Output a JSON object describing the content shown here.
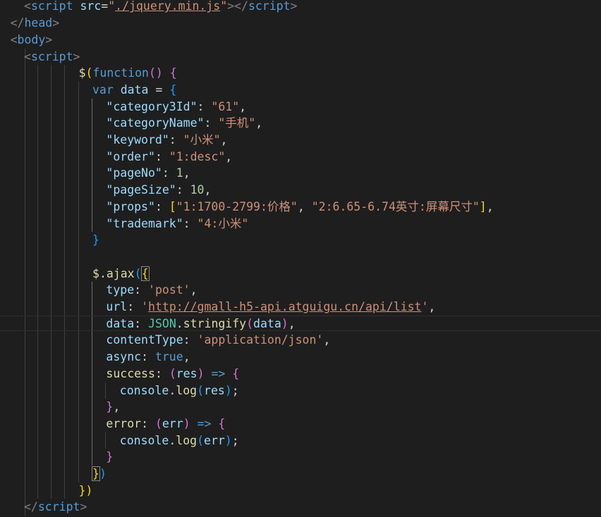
{
  "lines": [
    {
      "indent": 1,
      "tokens": [
        [
          "tk-punct",
          "<"
        ],
        [
          "tk-tag",
          "script"
        ],
        [
          "tk-plain",
          " "
        ],
        [
          "tk-attr",
          "src"
        ],
        [
          "tk-plain",
          "="
        ],
        [
          "tk-str",
          "\""
        ],
        [
          "tk-str u",
          "./jquery.min.js"
        ],
        [
          "tk-str",
          "\""
        ],
        [
          "tk-punct",
          "></"
        ],
        [
          "tk-tag",
          "script"
        ],
        [
          "tk-punct",
          ">"
        ]
      ]
    },
    {
      "indent": 0,
      "tokens": [
        [
          "tk-punct",
          "</"
        ],
        [
          "tk-tag",
          "head"
        ],
        [
          "tk-punct",
          ">"
        ]
      ]
    },
    {
      "indent": 0,
      "tokens": [
        [
          "tk-punct",
          "<"
        ],
        [
          "tk-tag",
          "body"
        ],
        [
          "tk-punct",
          ">"
        ]
      ]
    },
    {
      "indent": 1,
      "tokens": [
        [
          "tk-punct",
          "<"
        ],
        [
          "tk-tag",
          "script"
        ],
        [
          "tk-punct",
          ">"
        ]
      ]
    },
    {
      "indent": 5,
      "tokens": [
        [
          "tk-func",
          "$"
        ],
        [
          "b1",
          "("
        ],
        [
          "tk-kw",
          "function"
        ],
        [
          "b2",
          "()"
        ],
        [
          "tk-plain",
          " "
        ],
        [
          "b2",
          "{"
        ]
      ]
    },
    {
      "indent": 6,
      "tokens": [
        [
          "tk-kw",
          "var"
        ],
        [
          "tk-plain",
          " "
        ],
        [
          "tk-var",
          "data"
        ],
        [
          "tk-plain",
          " = "
        ],
        [
          "b3",
          "{"
        ]
      ]
    },
    {
      "indent": 7,
      "tokens": [
        [
          "tk-key",
          "\"category3Id\""
        ],
        [
          "tk-plain",
          ": "
        ],
        [
          "tk-str",
          "\"61\""
        ],
        [
          "tk-plain",
          ","
        ]
      ]
    },
    {
      "indent": 7,
      "tokens": [
        [
          "tk-key",
          "\"categoryName\""
        ],
        [
          "tk-plain",
          ": "
        ],
        [
          "tk-str",
          "\"手机\""
        ],
        [
          "tk-plain",
          ","
        ]
      ]
    },
    {
      "indent": 7,
      "tokens": [
        [
          "tk-key",
          "\"keyword\""
        ],
        [
          "tk-plain",
          ": "
        ],
        [
          "tk-str",
          "\"小米\""
        ],
        [
          "tk-plain",
          ","
        ]
      ]
    },
    {
      "indent": 7,
      "tokens": [
        [
          "tk-key",
          "\"order\""
        ],
        [
          "tk-plain",
          ": "
        ],
        [
          "tk-str",
          "\"1:desc\""
        ],
        [
          "tk-plain",
          ","
        ]
      ]
    },
    {
      "indent": 7,
      "tokens": [
        [
          "tk-key",
          "\"pageNo\""
        ],
        [
          "tk-plain",
          ": "
        ],
        [
          "tk-num",
          "1"
        ],
        [
          "tk-plain",
          ","
        ]
      ]
    },
    {
      "indent": 7,
      "tokens": [
        [
          "tk-key",
          "\"pageSize\""
        ],
        [
          "tk-plain",
          ": "
        ],
        [
          "tk-num",
          "10"
        ],
        [
          "tk-plain",
          ","
        ]
      ]
    },
    {
      "indent": 7,
      "tokens": [
        [
          "tk-key",
          "\"props\""
        ],
        [
          "tk-plain",
          ": "
        ],
        [
          "b1",
          "["
        ],
        [
          "tk-str",
          "\"1:1700-2799:价格\""
        ],
        [
          "tk-plain",
          ", "
        ],
        [
          "tk-str",
          "\"2:6.65-6.74英寸:屏幕尺寸\""
        ],
        [
          "b1",
          "]"
        ],
        [
          "tk-plain",
          ","
        ]
      ]
    },
    {
      "indent": 7,
      "tokens": [
        [
          "tk-key",
          "\"trademark\""
        ],
        [
          "tk-plain",
          ": "
        ],
        [
          "tk-str",
          "\"4:小米\""
        ]
      ]
    },
    {
      "indent": 6,
      "tokens": [
        [
          "b3",
          "}"
        ]
      ]
    },
    {
      "indent": 0,
      "tokens": []
    },
    {
      "indent": 6,
      "tokens": [
        [
          "tk-func",
          "$"
        ],
        [
          "tk-plain",
          "."
        ],
        [
          "tk-func",
          "ajax"
        ],
        [
          "b3",
          "("
        ],
        [
          "b1 box",
          "{"
        ]
      ]
    },
    {
      "indent": 7,
      "tokens": [
        [
          "tk-key",
          "type"
        ],
        [
          "tk-plain",
          ": "
        ],
        [
          "tk-str",
          "'post'"
        ],
        [
          "tk-plain",
          ","
        ]
      ]
    },
    {
      "indent": 7,
      "tokens": [
        [
          "tk-key",
          "url"
        ],
        [
          "tk-plain",
          ": "
        ],
        [
          "tk-str",
          "'"
        ],
        [
          "tk-str u",
          "http://gmall-h5-api.atguigu.cn/api/list"
        ],
        [
          "tk-str",
          "'"
        ],
        [
          "tk-plain",
          ","
        ]
      ]
    },
    {
      "indent": 7,
      "tokens": [
        [
          "tk-key",
          "data"
        ],
        [
          "tk-plain",
          ": "
        ],
        [
          "tk-obj",
          "JSON"
        ],
        [
          "tk-plain",
          "."
        ],
        [
          "tk-func",
          "stringify"
        ],
        [
          "b2",
          "("
        ],
        [
          "tk-var",
          "data"
        ],
        [
          "b2",
          ")"
        ],
        [
          "tk-plain",
          ","
        ]
      ],
      "current": true
    },
    {
      "indent": 7,
      "tokens": [
        [
          "tk-key",
          "contentType"
        ],
        [
          "tk-plain",
          ": "
        ],
        [
          "tk-str",
          "'application/json'"
        ],
        [
          "tk-plain",
          ","
        ]
      ]
    },
    {
      "indent": 7,
      "tokens": [
        [
          "tk-key",
          "async"
        ],
        [
          "tk-plain",
          ": "
        ],
        [
          "tk-kw",
          "true"
        ],
        [
          "tk-plain",
          ","
        ]
      ]
    },
    {
      "indent": 7,
      "tokens": [
        [
          "tk-func",
          "success"
        ],
        [
          "tk-plain",
          ": "
        ],
        [
          "b2",
          "("
        ],
        [
          "tk-var",
          "res"
        ],
        [
          "b2",
          ")"
        ],
        [
          "tk-plain",
          " "
        ],
        [
          "tk-kw",
          "=>"
        ],
        [
          "tk-plain",
          " "
        ],
        [
          "b2",
          "{"
        ]
      ]
    },
    {
      "indent": 8,
      "tokens": [
        [
          "tk-var",
          "console"
        ],
        [
          "tk-plain",
          "."
        ],
        [
          "tk-func",
          "log"
        ],
        [
          "b3",
          "("
        ],
        [
          "tk-var",
          "res"
        ],
        [
          "b3",
          ")"
        ],
        [
          "tk-plain",
          ";"
        ]
      ]
    },
    {
      "indent": 7,
      "tokens": [
        [
          "b2",
          "}"
        ],
        [
          "tk-plain",
          ","
        ]
      ]
    },
    {
      "indent": 7,
      "tokens": [
        [
          "tk-func",
          "error"
        ],
        [
          "tk-plain",
          ": "
        ],
        [
          "b2",
          "("
        ],
        [
          "tk-var",
          "err"
        ],
        [
          "b2",
          ")"
        ],
        [
          "tk-plain",
          " "
        ],
        [
          "tk-kw",
          "=>"
        ],
        [
          "tk-plain",
          " "
        ],
        [
          "b2",
          "{"
        ]
      ]
    },
    {
      "indent": 8,
      "tokens": [
        [
          "tk-var",
          "console"
        ],
        [
          "tk-plain",
          "."
        ],
        [
          "tk-func",
          "log"
        ],
        [
          "b3",
          "("
        ],
        [
          "tk-var",
          "err"
        ],
        [
          "b3",
          ")"
        ],
        [
          "tk-plain",
          ";"
        ]
      ]
    },
    {
      "indent": 7,
      "tokens": [
        [
          "b2",
          "}"
        ]
      ]
    },
    {
      "indent": 6,
      "tokens": [
        [
          "b1 box",
          "}"
        ],
        [
          "b3",
          ")"
        ]
      ]
    },
    {
      "indent": 5,
      "tokens": [
        [
          "b1",
          "})"
        ]
      ]
    },
    {
      "indent": 1,
      "tokens": [
        [
          "tk-punct",
          "</"
        ],
        [
          "tk-tag",
          "script"
        ],
        [
          "tk-punct",
          ">"
        ]
      ]
    }
  ]
}
